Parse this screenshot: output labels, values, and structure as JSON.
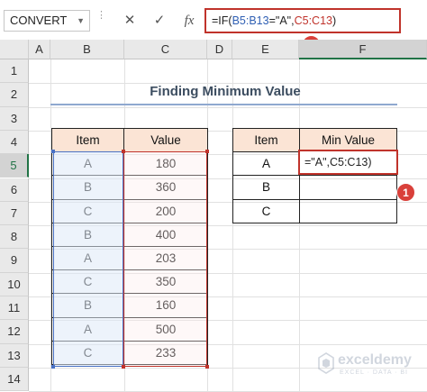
{
  "name_box": {
    "value": "CONVERT"
  },
  "formula_bar": {
    "cancel_glyph": "✕",
    "enter_glyph": "✓",
    "fx_label": "fx",
    "formula_parts": [
      "=IF(",
      "B5:B13",
      "=\"A\",",
      "C5:C13",
      ")"
    ]
  },
  "badges": {
    "formula_bar": "2",
    "cell": "1"
  },
  "columns": [
    "A",
    "B",
    "C",
    "D",
    "E",
    "F"
  ],
  "rows": [
    "1",
    "2",
    "3",
    "4",
    "5",
    "6",
    "7",
    "8",
    "9",
    "10",
    "11",
    "12",
    "13",
    "14"
  ],
  "title": "Finding Minimum Value",
  "data_table": {
    "headers": [
      "Item",
      "Value"
    ],
    "rows": [
      [
        "A",
        "180"
      ],
      [
        "B",
        "360"
      ],
      [
        "C",
        "200"
      ],
      [
        "B",
        "400"
      ],
      [
        "A",
        "203"
      ],
      [
        "C",
        "350"
      ],
      [
        "B",
        "160"
      ],
      [
        "A",
        "500"
      ],
      [
        "C",
        "233"
      ]
    ]
  },
  "result_table": {
    "headers": [
      "Item",
      "Min Value"
    ],
    "items": [
      "A",
      "B",
      "C"
    ],
    "editing_text": "=\"A\",C5:C13)"
  },
  "watermark": {
    "name": "exceldemy",
    "tagline": "EXCEL · DATA · BI"
  },
  "colors": {
    "accent_red": "#c0332b",
    "range_blue": "#4a72c4",
    "header_fill": "#fbe4d5",
    "excel_green": "#217346"
  }
}
